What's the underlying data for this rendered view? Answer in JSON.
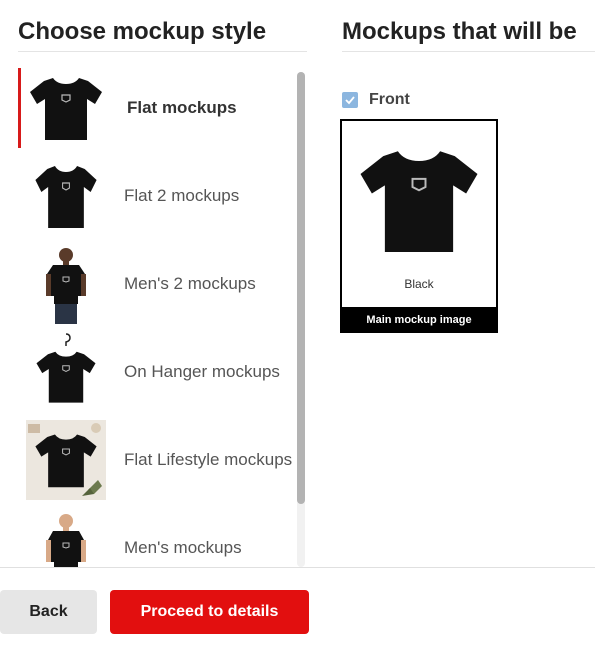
{
  "left_panel": {
    "title": "Choose mockup style",
    "items": [
      {
        "label": "Flat mockups",
        "thumb": "tshirt-flat-icon",
        "selected": true
      },
      {
        "label": "Flat 2 mockups",
        "thumb": "tshirt-flat-icon",
        "selected": false
      },
      {
        "label": "Men's 2 mockups",
        "thumb": "man-wearing-tshirt-icon",
        "selected": false
      },
      {
        "label": "On Hanger mockups",
        "thumb": "tshirt-hanger-icon",
        "selected": false
      },
      {
        "label": "Flat Lifestyle mockups",
        "thumb": "tshirt-lifestyle-icon",
        "selected": false
      },
      {
        "label": "Men's mockups",
        "thumb": "man-wearing-tshirt-icon",
        "selected": false
      }
    ]
  },
  "right_panel": {
    "title": "Mockups that will be",
    "front_label": "Front",
    "front_checked": true,
    "card": {
      "color_name": "Black",
      "caption": "Main mockup image"
    }
  },
  "footer": {
    "back_label": "Back",
    "proceed_label": "Proceed to details"
  },
  "colors": {
    "accent": "#e20f0f",
    "selected_bar": "#d71a1a",
    "checkbox": "#8cb6df",
    "shirt": "#111111"
  }
}
